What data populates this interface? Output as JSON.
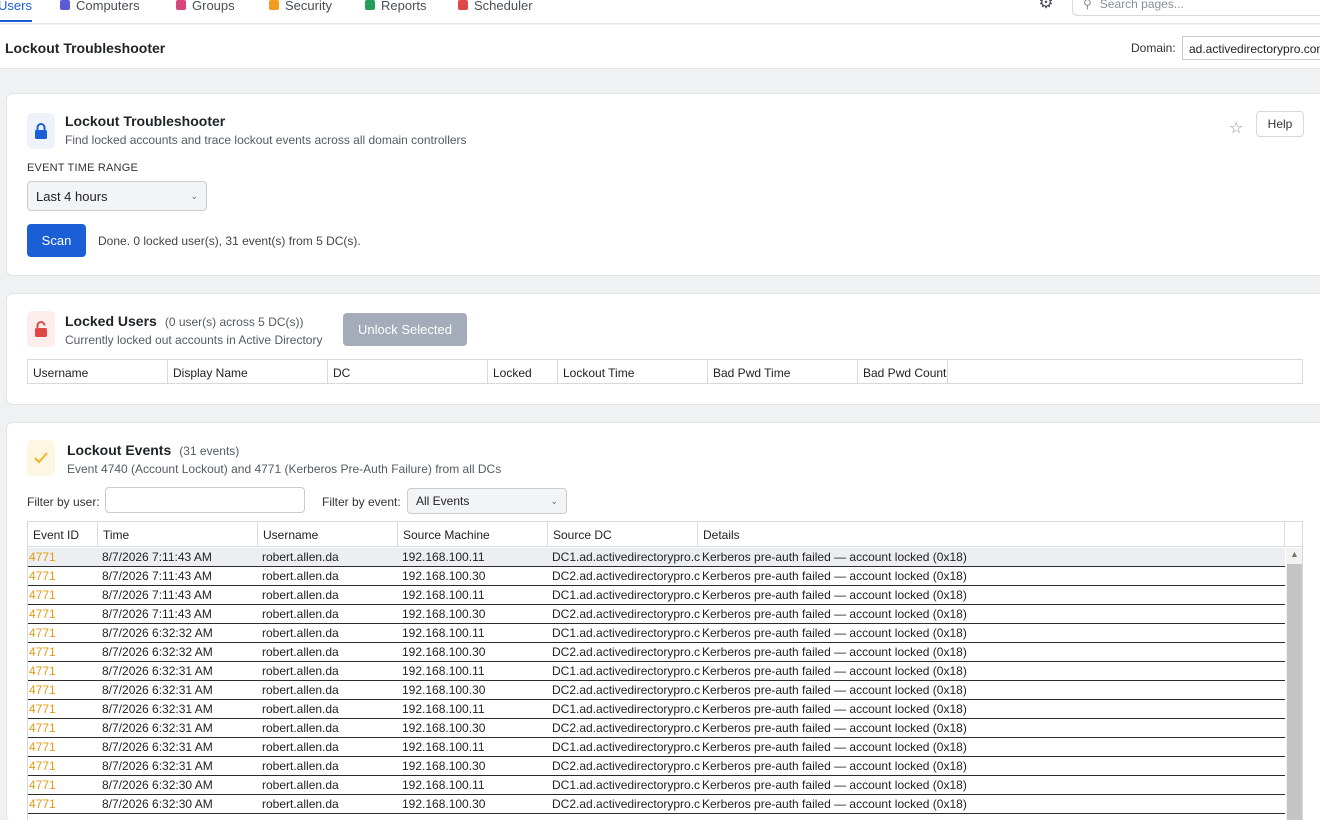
{
  "nav": {
    "tabs": [
      {
        "label": "Users",
        "color": "#1a5fd6"
      },
      {
        "label": "Computers",
        "color": "#5b5bd6"
      },
      {
        "label": "Groups",
        "color": "#d6457c"
      },
      {
        "label": "Security",
        "color": "#f29b1d"
      },
      {
        "label": "Reports",
        "color": "#22a05b"
      },
      {
        "label": "Scheduler",
        "color": "#e04848"
      }
    ],
    "search_placeholder": "Search pages..."
  },
  "header": {
    "title": "Lockout Troubleshooter",
    "domain_label": "Domain:",
    "domain_value": "ad.activedirectorypro.com"
  },
  "troubleshooter": {
    "title": "Lockout Troubleshooter",
    "subtitle": "Find locked accounts and trace lockout events across all domain controllers",
    "help_label": "Help",
    "time_range_label": "EVENT TIME RANGE",
    "time_range_value": "Last 4 hours",
    "scan_label": "Scan",
    "status": "Done. 0 locked user(s), 31 event(s) from 5 DC(s)."
  },
  "locked_users": {
    "title": "Locked Users",
    "meta": "(0 user(s) across 5 DC(s))",
    "subtitle": "Currently locked out accounts in Active Directory",
    "unlock_label": "Unlock Selected",
    "columns": [
      "Username",
      "Display Name",
      "DC",
      "Locked",
      "Lockout Time",
      "Bad Pwd Time",
      "Bad Pwd Count"
    ]
  },
  "lockout_events": {
    "title": "Lockout Events",
    "meta": "(31 events)",
    "subtitle": "Event 4740 (Account Lockout) and 4771 (Kerberos Pre-Auth Failure) from all DCs",
    "filter_user_label": "Filter by user:",
    "filter_event_label": "Filter by event:",
    "filter_event_value": "All Events",
    "columns": [
      "Event ID",
      "Time",
      "Username",
      "Source Machine",
      "Source DC",
      "Details"
    ],
    "rows": [
      {
        "id": "4771",
        "time": "8/7/2026 7:11:43 AM",
        "user": "robert.allen.da",
        "machine": "192.168.100.11",
        "dc": "DC1.ad.activedirectorypro.c",
        "details": "Kerberos pre-auth failed — account locked (0x18)"
      },
      {
        "id": "4771",
        "time": "8/7/2026 7:11:43 AM",
        "user": "robert.allen.da",
        "machine": "192.168.100.30",
        "dc": "DC2.ad.activedirectorypro.c",
        "details": "Kerberos pre-auth failed — account locked (0x18)"
      },
      {
        "id": "4771",
        "time": "8/7/2026 7:11:43 AM",
        "user": "robert.allen.da",
        "machine": "192.168.100.11",
        "dc": "DC1.ad.activedirectorypro.c",
        "details": "Kerberos pre-auth failed — account locked (0x18)"
      },
      {
        "id": "4771",
        "time": "8/7/2026 7:11:43 AM",
        "user": "robert.allen.da",
        "machine": "192.168.100.30",
        "dc": "DC2.ad.activedirectorypro.c",
        "details": "Kerberos pre-auth failed — account locked (0x18)"
      },
      {
        "id": "4771",
        "time": "8/7/2026 6:32:32 AM",
        "user": "robert.allen.da",
        "machine": "192.168.100.11",
        "dc": "DC1.ad.activedirectorypro.c",
        "details": "Kerberos pre-auth failed — account locked (0x18)"
      },
      {
        "id": "4771",
        "time": "8/7/2026 6:32:32 AM",
        "user": "robert.allen.da",
        "machine": "192.168.100.30",
        "dc": "DC2.ad.activedirectorypro.c",
        "details": "Kerberos pre-auth failed — account locked (0x18)"
      },
      {
        "id": "4771",
        "time": "8/7/2026 6:32:31 AM",
        "user": "robert.allen.da",
        "machine": "192.168.100.11",
        "dc": "DC1.ad.activedirectorypro.c",
        "details": "Kerberos pre-auth failed — account locked (0x18)"
      },
      {
        "id": "4771",
        "time": "8/7/2026 6:32:31 AM",
        "user": "robert.allen.da",
        "machine": "192.168.100.30",
        "dc": "DC2.ad.activedirectorypro.c",
        "details": "Kerberos pre-auth failed — account locked (0x18)"
      },
      {
        "id": "4771",
        "time": "8/7/2026 6:32:31 AM",
        "user": "robert.allen.da",
        "machine": "192.168.100.11",
        "dc": "DC1.ad.activedirectorypro.c",
        "details": "Kerberos pre-auth failed — account locked (0x18)"
      },
      {
        "id": "4771",
        "time": "8/7/2026 6:32:31 AM",
        "user": "robert.allen.da",
        "machine": "192.168.100.30",
        "dc": "DC2.ad.activedirectorypro.c",
        "details": "Kerberos pre-auth failed — account locked (0x18)"
      },
      {
        "id": "4771",
        "time": "8/7/2026 6:32:31 AM",
        "user": "robert.allen.da",
        "machine": "192.168.100.11",
        "dc": "DC1.ad.activedirectorypro.c",
        "details": "Kerberos pre-auth failed — account locked (0x18)"
      },
      {
        "id": "4771",
        "time": "8/7/2026 6:32:31 AM",
        "user": "robert.allen.da",
        "machine": "192.168.100.30",
        "dc": "DC2.ad.activedirectorypro.c",
        "details": "Kerberos pre-auth failed — account locked (0x18)"
      },
      {
        "id": "4771",
        "time": "8/7/2026 6:32:30 AM",
        "user": "robert.allen.da",
        "machine": "192.168.100.11",
        "dc": "DC1.ad.activedirectorypro.c",
        "details": "Kerberos pre-auth failed — account locked (0x18)"
      },
      {
        "id": "4771",
        "time": "8/7/2026 6:32:30 AM",
        "user": "robert.allen.da",
        "machine": "192.168.100.30",
        "dc": "DC2.ad.activedirectorypro.c",
        "details": "Kerberos pre-auth failed — account locked (0x18)"
      }
    ]
  },
  "icons": {
    "computers": "monitor-icon",
    "groups": "group-icon",
    "security": "shield-icon",
    "reports": "report-icon",
    "scheduler": "calendar-icon",
    "settings": "gear-icon",
    "search": "search-icon",
    "lock": "lock-icon",
    "check": "check-icon",
    "star": "star-icon"
  },
  "colors": {
    "accent": "#1a5fd6",
    "event_id": "#e59b12",
    "unlock_disabled": "#a3acb8"
  }
}
